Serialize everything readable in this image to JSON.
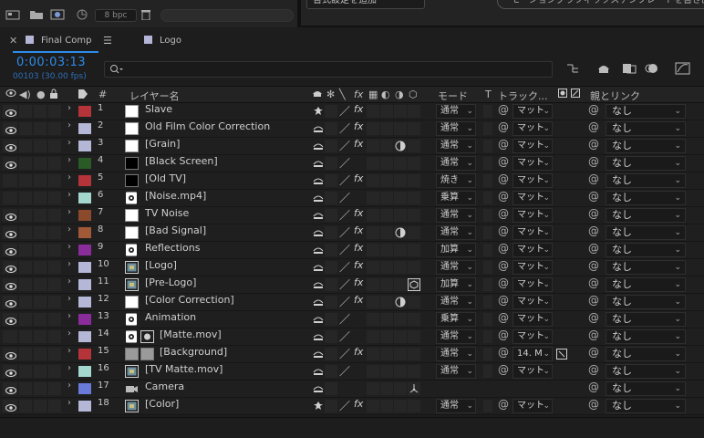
{
  "topbar": {
    "bpc": "8 bpc",
    "dropdown": "書式設定を追加",
    "essential_pill": "モーショングラフィックステンプレートを書き出し"
  },
  "tabs": [
    {
      "label": "Final Comp"
    },
    {
      "label": "Logo"
    }
  ],
  "time": {
    "timecode": "0:00:03:13",
    "fps": "00103 (30.00 fps)"
  },
  "header": {
    "layer_name": "レイヤー名",
    "num": "#",
    "mode": "モード",
    "t": "T",
    "track": "トラック...",
    "parent": "親とリンク"
  },
  "colors": {
    "accent": "#2d8ceb",
    "bg": "#1f1f1f"
  },
  "layers": [
    {
      "num": "1",
      "name": "Slave",
      "label_color": "#b4343a",
      "thumb": "white",
      "eye": true,
      "shy_icon": "puppet",
      "slash": true,
      "fx": true,
      "qual": "",
      "mode": "通常",
      "track": "マット",
      "parent": "なし"
    },
    {
      "num": "2",
      "name": "Old Film Color Correction",
      "label_color": "#b4b7d6",
      "thumb": "white",
      "eye": true,
      "shy_icon": "shy",
      "slash": true,
      "fx": true,
      "qual": "",
      "mode": "通常",
      "track": "マット",
      "parent": "なし"
    },
    {
      "num": "3",
      "name": "[Grain]",
      "label_color": "#b4b7d6",
      "thumb": "white",
      "eye": true,
      "shy_icon": "shy",
      "slash": true,
      "fx": true,
      "qual": "motionblur",
      "mode": "通常",
      "track": "マット",
      "parent": "なし"
    },
    {
      "num": "4",
      "name": "[Black Screen]",
      "label_color": "#2a5a26",
      "thumb": "black",
      "eye": true,
      "shy_icon": "shy",
      "slash": true,
      "fx": false,
      "qual": "",
      "mode": "通常",
      "track": "マット",
      "parent": "なし"
    },
    {
      "num": "5",
      "name": "[Old TV]",
      "label_color": "#b4343a",
      "thumb": "black",
      "eye": false,
      "shy_icon": "shy",
      "slash": true,
      "fx": true,
      "qual": "",
      "mode": "焼き",
      "track": "マット",
      "parent": "なし"
    },
    {
      "num": "6",
      "name": "[Noise.mp4]",
      "label_color": "#a4d8cf",
      "thumb": "video",
      "eye": false,
      "shy_icon": "shy",
      "slash": true,
      "fx": false,
      "qual": "",
      "mode": "乗算",
      "track": "マット",
      "parent": "なし"
    },
    {
      "num": "7",
      "name": "TV Noise",
      "label_color": "#8c4a2c",
      "thumb": "white",
      "eye": true,
      "shy_icon": "shy",
      "slash": true,
      "fx": true,
      "qual": "",
      "mode": "通常",
      "track": "マット",
      "parent": "なし"
    },
    {
      "num": "8",
      "name": "[Bad Signal]",
      "label_color": "#a05a38",
      "thumb": "white",
      "eye": true,
      "shy_icon": "shy",
      "slash": true,
      "fx": true,
      "qual": "motionblur",
      "mode": "通常",
      "track": "マット",
      "parent": "なし"
    },
    {
      "num": "9",
      "name": "Reflections",
      "label_color": "#8a2c9a",
      "thumb": "video",
      "eye": true,
      "shy_icon": "shy",
      "slash": true,
      "fx": true,
      "qual": "",
      "mode": "加算",
      "track": "マット",
      "parent": "なし"
    },
    {
      "num": "10",
      "name": "[Logo]",
      "label_color": "#b4b7d6",
      "thumb": "comp",
      "eye": true,
      "shy_icon": "shy",
      "slash": true,
      "fx": true,
      "qual": "",
      "mode": "通常",
      "track": "マット",
      "parent": "なし"
    },
    {
      "num": "11",
      "name": "[Pre-Logo]",
      "label_color": "#b4b7d6",
      "thumb": "comp",
      "eye": true,
      "shy_icon": "shy",
      "slash": true,
      "fx": true,
      "qual": "3d",
      "mode": "加算",
      "track": "マット",
      "parent": "なし"
    },
    {
      "num": "12",
      "name": "[Color Correction]",
      "label_color": "#b4b7d6",
      "thumb": "white",
      "eye": true,
      "shy_icon": "shy",
      "slash": true,
      "fx": true,
      "qual": "motionblur",
      "mode": "通常",
      "track": "マット",
      "parent": "なし"
    },
    {
      "num": "13",
      "name": "Animation",
      "label_color": "#8a2c9a",
      "thumb": "video",
      "eye": true,
      "shy_icon": "shy",
      "slash": true,
      "fx": false,
      "qual": "",
      "mode": "乗算",
      "track": "マット",
      "parent": "なし"
    },
    {
      "num": "14",
      "name": "[Matte.mov]",
      "label_color": "#b4b7d6",
      "thumb": "video",
      "eye": false,
      "shy_icon": "shy",
      "slash": true,
      "fx": false,
      "qual": "",
      "mode": "通常",
      "track": "マット",
      "parent": "なし",
      "track_icon": true
    },
    {
      "num": "15",
      "name": "[Background]",
      "label_color": "#b4343a",
      "thumb": "gray",
      "eye": true,
      "shy_icon": "shy",
      "slash": true,
      "fx": true,
      "qual": "",
      "mode": "通常",
      "track": "14. M",
      "parent": "なし",
      "indent": true,
      "track_link": true
    },
    {
      "num": "16",
      "name": "[TV Matte.mov]",
      "label_color": "#a4d8cf",
      "thumb": "comp",
      "eye": true,
      "shy_icon": "shy",
      "slash": true,
      "fx": false,
      "qual": "",
      "mode": "通常",
      "track": "マット",
      "parent": "なし"
    },
    {
      "num": "17",
      "name": "Camera",
      "label_color": "#6a7ad8",
      "thumb": "camera",
      "eye": true,
      "shy_icon": "shy",
      "slash": false,
      "fx": false,
      "qual": "camera",
      "mode": "",
      "track": "",
      "parent": "なし"
    },
    {
      "num": "18",
      "name": "[Color]",
      "label_color": "#b4b7d6",
      "thumb": "comp",
      "eye": true,
      "shy_icon": "puppet",
      "slash": true,
      "fx": true,
      "qual": "",
      "mode": "通常",
      "track": "マット",
      "parent": "なし"
    }
  ]
}
